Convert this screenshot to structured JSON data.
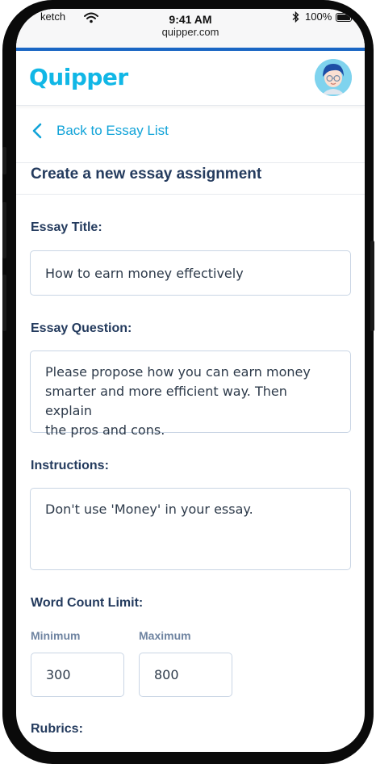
{
  "status_bar": {
    "carrier": "ketch",
    "time": "9:41 AM",
    "url": "quipper.com",
    "battery": "100%"
  },
  "header": {
    "logo": "Quipper",
    "logo_color": "#11b7e6",
    "accent_color": "#1a66c4"
  },
  "nav": {
    "back_label": "Back to Essay List"
  },
  "page": {
    "title": "Create a new essay assignment"
  },
  "form": {
    "essay_title": {
      "label": "Essay Title:",
      "value": "How to earn money effectively"
    },
    "essay_question": {
      "label": "Essay Question:",
      "value": "Please propose how you can earn money\nsmarter and more efficient way. Then explain\nthe pros and cons."
    },
    "instructions": {
      "label": "Instructions:",
      "value": "Don't use 'Money' in your essay."
    },
    "word_count": {
      "label": "Word Count Limit:",
      "min_label": "Minimum",
      "min_value": "300",
      "max_label": "Maximum",
      "max_value": "800"
    },
    "rubrics": {
      "label": "Rubrics:"
    }
  }
}
